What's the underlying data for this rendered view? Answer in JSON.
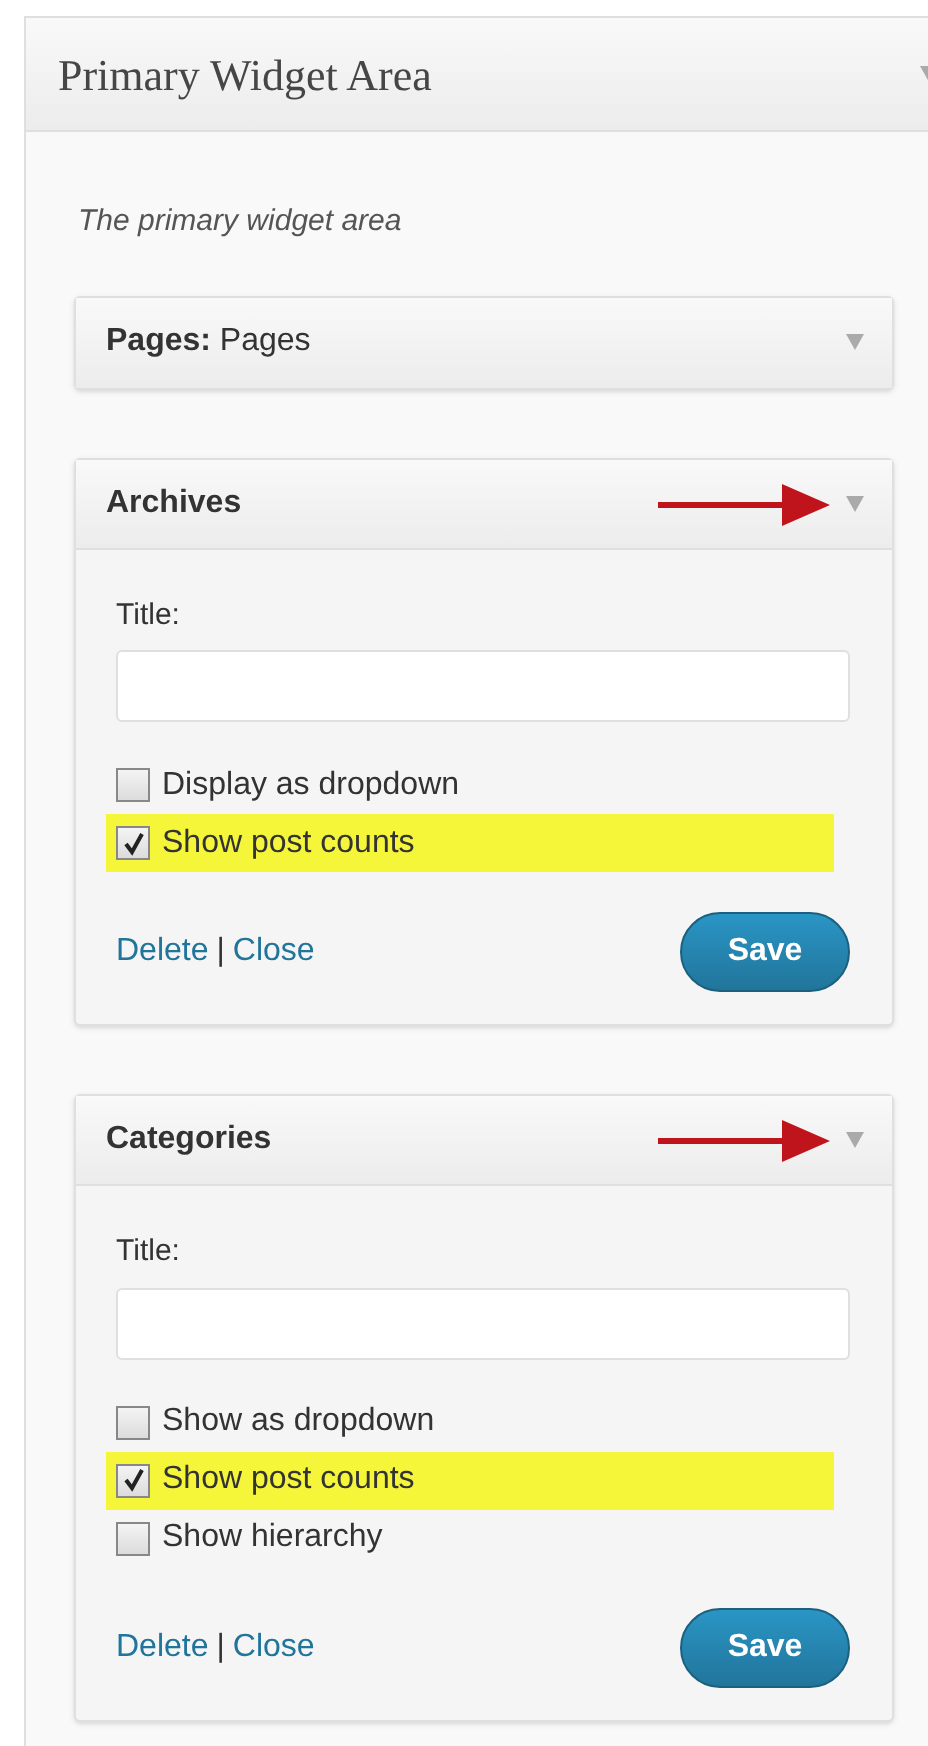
{
  "sidebar": {
    "title": "Primary Widget Area",
    "description": "The primary widget area",
    "widgets": [
      {
        "title": "**Pages:** Pages",
        "expanded": false,
        "arrow": false
      },
      {
        "title": "Archives",
        "expanded": true,
        "arrow": true,
        "field_label": "Title:",
        "options": [
          {
            "label": "Display as dropdown",
            "checked": false,
            "highlighted": false
          },
          {
            "label": "Show post counts",
            "checked": true,
            "highlighted": true
          }
        ],
        "links": [
          "Delete",
          "Close"
        ],
        "separator": "|",
        "button": "Save"
      },
      {
        "title": "Categories",
        "expanded": true,
        "arrow": true,
        "field_label": "Title:",
        "options": [
          {
            "label": "Show as dropdown",
            "checked": false,
            "highlighted": false
          },
          {
            "label": "Show post counts",
            "checked": true,
            "highlighted": true
          },
          {
            "label": "Show hierarchy",
            "checked": false,
            "highlighted": false
          }
        ],
        "links": [
          "Delete",
          "Close"
        ],
        "separator": "|",
        "button": "Save"
      }
    ]
  }
}
